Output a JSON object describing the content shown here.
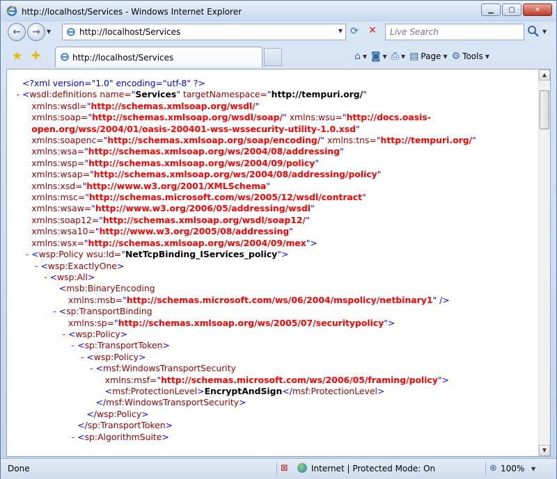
{
  "window": {
    "title": "http://localhost/Services - Windows Internet Explorer",
    "minimize": "▁",
    "maximize": "▢",
    "close": "✕"
  },
  "address": {
    "url": "http://localhost/Services"
  },
  "search": {
    "placeholder": "Live Search"
  },
  "tab": {
    "label": "http://localhost/Services"
  },
  "commands": {
    "page": "Page",
    "tools": "Tools"
  },
  "status": {
    "text": "Done",
    "zone": "Internet | Protected Mode: On",
    "zoom": "100%"
  },
  "xml_lines": [
    {
      "indent": 0,
      "marker": "",
      "parts": [
        [
          "pi",
          "<?xml version=\"1.0\" encoding=\"utf-8\" ?>"
        ]
      ]
    },
    {
      "indent": 0,
      "marker": "-",
      "parts": [
        [
          "b",
          "<"
        ],
        [
          "t",
          "wsdl:definitions"
        ],
        [
          "t",
          " name="
        ],
        [
          "b",
          "\""
        ],
        [
          "v",
          "Services"
        ],
        [
          "b",
          "\""
        ],
        [
          "t",
          " targetNamespace="
        ],
        [
          "b",
          "\""
        ],
        [
          "v",
          "http://tempuri.org/"
        ],
        [
          "b",
          "\""
        ]
      ]
    },
    {
      "indent": 1,
      "marker": "",
      "parts": [
        [
          "t",
          "xmlns:wsdl="
        ],
        [
          "b",
          "\""
        ],
        [
          "av",
          "http://schemas.xmlsoap.org/wsdl/"
        ],
        [
          "b",
          "\""
        ]
      ]
    },
    {
      "indent": 1,
      "marker": "",
      "parts": [
        [
          "t",
          "xmlns:soap="
        ],
        [
          "b",
          "\""
        ],
        [
          "av",
          "http://schemas.xmlsoap.org/wsdl/soap/"
        ],
        [
          "b",
          "\""
        ],
        [
          "t",
          " xmlns:wsu="
        ],
        [
          "b",
          "\""
        ],
        [
          "av",
          "http://docs.oasis-"
        ]
      ]
    },
    {
      "indent": 1,
      "marker": "",
      "parts": [
        [
          "av",
          "open.org/wss/2004/01/oasis-200401-wss-wssecurity-utility-1.0.xsd"
        ],
        [
          "b",
          "\""
        ]
      ]
    },
    {
      "indent": 1,
      "marker": "",
      "parts": [
        [
          "t",
          "xmlns:soapenc="
        ],
        [
          "b",
          "\""
        ],
        [
          "av",
          "http://schemas.xmlsoap.org/soap/encoding/"
        ],
        [
          "b",
          "\""
        ],
        [
          "t",
          " xmlns:tns="
        ],
        [
          "b",
          "\""
        ],
        [
          "av",
          "http://tempuri.org/"
        ],
        [
          "b",
          "\""
        ]
      ]
    },
    {
      "indent": 1,
      "marker": "",
      "parts": [
        [
          "t",
          "xmlns:wsa="
        ],
        [
          "b",
          "\""
        ],
        [
          "av",
          "http://schemas.xmlsoap.org/ws/2004/08/addressing"
        ],
        [
          "b",
          "\""
        ]
      ]
    },
    {
      "indent": 1,
      "marker": "",
      "parts": [
        [
          "t",
          "xmlns:wsp="
        ],
        [
          "b",
          "\""
        ],
        [
          "av",
          "http://schemas.xmlsoap.org/ws/2004/09/policy"
        ],
        [
          "b",
          "\""
        ]
      ]
    },
    {
      "indent": 1,
      "marker": "",
      "parts": [
        [
          "t",
          "xmlns:wsap="
        ],
        [
          "b",
          "\""
        ],
        [
          "av",
          "http://schemas.xmlsoap.org/ws/2004/08/addressing/policy"
        ],
        [
          "b",
          "\""
        ]
      ]
    },
    {
      "indent": 1,
      "marker": "",
      "parts": [
        [
          "t",
          "xmlns:xsd="
        ],
        [
          "b",
          "\""
        ],
        [
          "av",
          "http://www.w3.org/2001/XMLSchema"
        ],
        [
          "b",
          "\""
        ]
      ]
    },
    {
      "indent": 1,
      "marker": "",
      "parts": [
        [
          "t",
          "xmlns:msc="
        ],
        [
          "b",
          "\""
        ],
        [
          "av",
          "http://schemas.microsoft.com/ws/2005/12/wsdl/contract"
        ],
        [
          "b",
          "\""
        ]
      ]
    },
    {
      "indent": 1,
      "marker": "",
      "parts": [
        [
          "t",
          "xmlns:wsaw="
        ],
        [
          "b",
          "\""
        ],
        [
          "av",
          "http://www.w3.org/2006/05/addressing/wsdl"
        ],
        [
          "b",
          "\""
        ]
      ]
    },
    {
      "indent": 1,
      "marker": "",
      "parts": [
        [
          "t",
          "xmlns:soap12="
        ],
        [
          "b",
          "\""
        ],
        [
          "av",
          "http://schemas.xmlsoap.org/wsdl/soap12/"
        ],
        [
          "b",
          "\""
        ]
      ]
    },
    {
      "indent": 1,
      "marker": "",
      "parts": [
        [
          "t",
          "xmlns:wsa10="
        ],
        [
          "b",
          "\""
        ],
        [
          "av",
          "http://www.w3.org/2005/08/addressing"
        ],
        [
          "b",
          "\""
        ]
      ]
    },
    {
      "indent": 1,
      "marker": "",
      "parts": [
        [
          "t",
          "xmlns:wsx="
        ],
        [
          "b",
          "\""
        ],
        [
          "av",
          "http://schemas.xmlsoap.org/ws/2004/09/mex"
        ],
        [
          "b",
          "\">"
        ]
      ]
    },
    {
      "indent": 1,
      "marker": "-",
      "parts": [
        [
          "b",
          "<"
        ],
        [
          "t",
          "wsp:Policy"
        ],
        [
          "t",
          " wsu:Id="
        ],
        [
          "b",
          "\""
        ],
        [
          "v",
          "NetTcpBinding_IServices_policy"
        ],
        [
          "b",
          "\">"
        ]
      ]
    },
    {
      "indent": 2,
      "marker": "-",
      "parts": [
        [
          "b",
          "<"
        ],
        [
          "t",
          "wsp:ExactlyOne"
        ],
        [
          "b",
          ">"
        ]
      ]
    },
    {
      "indent": 3,
      "marker": "-",
      "parts": [
        [
          "b",
          "<"
        ],
        [
          "t",
          "wsp:All"
        ],
        [
          "b",
          ">"
        ]
      ]
    },
    {
      "indent": 4,
      "marker": "",
      "parts": [
        [
          "b",
          "<"
        ],
        [
          "t",
          "msb:BinaryEncoding"
        ]
      ]
    },
    {
      "indent": 5,
      "marker": "",
      "parts": [
        [
          "t",
          "xmlns:msb="
        ],
        [
          "b",
          "\""
        ],
        [
          "av",
          "http://schemas.microsoft.com/ws/06/2004/mspolicy/netbinary1"
        ],
        [
          "b",
          "\" />"
        ]
      ]
    },
    {
      "indent": 4,
      "marker": "-",
      "parts": [
        [
          "b",
          "<"
        ],
        [
          "t",
          "sp:TransportBinding"
        ]
      ]
    },
    {
      "indent": 5,
      "marker": "",
      "parts": [
        [
          "t",
          "xmlns:sp="
        ],
        [
          "b",
          "\""
        ],
        [
          "av",
          "http://schemas.xmlsoap.org/ws/2005/07/securitypolicy"
        ],
        [
          "b",
          "\">"
        ]
      ]
    },
    {
      "indent": 5,
      "marker": "-",
      "parts": [
        [
          "b",
          "<"
        ],
        [
          "t",
          "wsp:Policy"
        ],
        [
          "b",
          ">"
        ]
      ]
    },
    {
      "indent": 6,
      "marker": "-",
      "parts": [
        [
          "b",
          "<"
        ],
        [
          "t",
          "sp:TransportToken"
        ],
        [
          "b",
          ">"
        ]
      ]
    },
    {
      "indent": 7,
      "marker": "-",
      "parts": [
        [
          "b",
          "<"
        ],
        [
          "t",
          "wsp:Policy"
        ],
        [
          "b",
          ">"
        ]
      ]
    },
    {
      "indent": 8,
      "marker": "-",
      "parts": [
        [
          "b",
          "<"
        ],
        [
          "t",
          "msf:WindowsTransportSecurity"
        ]
      ]
    },
    {
      "indent": 9,
      "marker": "",
      "parts": [
        [
          "t",
          "xmlns:msf="
        ],
        [
          "b",
          "\""
        ],
        [
          "av",
          "http://schemas.microsoft.com/ws/2006/05/framing/policy"
        ],
        [
          "b",
          "\">"
        ]
      ]
    },
    {
      "indent": 9,
      "marker": "",
      "parts": [
        [
          "b",
          "<"
        ],
        [
          "t",
          "msf:ProtectionLevel"
        ],
        [
          "b",
          ">"
        ],
        [
          "v",
          "EncryptAndSign"
        ],
        [
          "b",
          "</"
        ],
        [
          "t",
          "msf:ProtectionLevel"
        ],
        [
          "b",
          ">"
        ]
      ]
    },
    {
      "indent": 8,
      "marker": "",
      "parts": [
        [
          "b",
          "</"
        ],
        [
          "t",
          "msf:WindowsTransportSecurity"
        ],
        [
          "b",
          ">"
        ]
      ]
    },
    {
      "indent": 7,
      "marker": "",
      "parts": [
        [
          "b",
          "</"
        ],
        [
          "t",
          "wsp:Policy"
        ],
        [
          "b",
          ">"
        ]
      ]
    },
    {
      "indent": 6,
      "marker": "",
      "parts": [
        [
          "b",
          "</"
        ],
        [
          "t",
          "sp:TransportToken"
        ],
        [
          "b",
          ">"
        ]
      ]
    },
    {
      "indent": 6,
      "marker": "-",
      "parts": [
        [
          "b",
          "<"
        ],
        [
          "t",
          "sp:AlgorithmSuite"
        ],
        [
          "b",
          ">"
        ]
      ]
    }
  ]
}
